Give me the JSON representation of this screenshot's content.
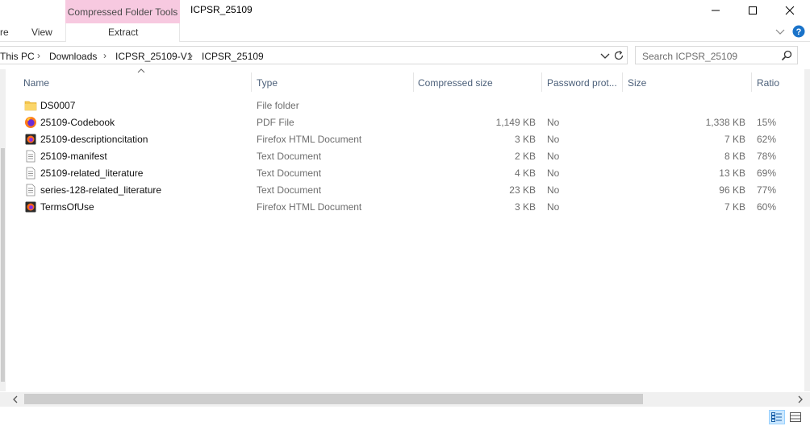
{
  "titlebar": {
    "context_tab": "Compressed Folder Tools",
    "window_title": "ICPSR_25109"
  },
  "ribbon": {
    "tabs": [
      {
        "label": "re"
      },
      {
        "label": "View"
      },
      {
        "label": "Extract"
      }
    ]
  },
  "address": {
    "crumbs": [
      "This PC",
      "Downloads",
      "ICPSR_25109-V1",
      "ICPSR_25109"
    ]
  },
  "search": {
    "placeholder": "Search ICPSR_25109"
  },
  "columns": [
    "Name",
    "Type",
    "Compressed size",
    "Password prot...",
    "Size",
    "Ratio"
  ],
  "files": [
    {
      "name": "DS0007",
      "type": "File folder",
      "compressed": "",
      "password": "",
      "size": "",
      "ratio": "",
      "icon": "folder-icon"
    },
    {
      "name": "25109-Codebook",
      "type": "PDF File",
      "compressed": "1,149 KB",
      "password": "No",
      "size": "1,338 KB",
      "ratio": "15%",
      "icon": "firefox-pdf-icon"
    },
    {
      "name": "25109-descriptioncitation",
      "type": "Firefox HTML Document",
      "compressed": "3 KB",
      "password": "No",
      "size": "7 KB",
      "ratio": "62%",
      "icon": "firefox-html-icon"
    },
    {
      "name": "25109-manifest",
      "type": "Text Document",
      "compressed": "2 KB",
      "password": "No",
      "size": "8 KB",
      "ratio": "78%",
      "icon": "text-document-icon"
    },
    {
      "name": "25109-related_literature",
      "type": "Text Document",
      "compressed": "4 KB",
      "password": "No",
      "size": "13 KB",
      "ratio": "69%",
      "icon": "text-document-icon"
    },
    {
      "name": "series-128-related_literature",
      "type": "Text Document",
      "compressed": "23 KB",
      "password": "No",
      "size": "96 KB",
      "ratio": "77%",
      "icon": "text-document-icon"
    },
    {
      "name": "TermsOfUse",
      "type": "Firefox HTML Document",
      "compressed": "3 KB",
      "password": "No",
      "size": "7 KB",
      "ratio": "60%",
      "icon": "firefox-html-icon"
    }
  ],
  "colors": {
    "context_tab_bg": "#f7c9e0",
    "header_text": "#4c607a",
    "help_blue": "#1a73c9",
    "folder_yellow": "#f4c64f"
  }
}
